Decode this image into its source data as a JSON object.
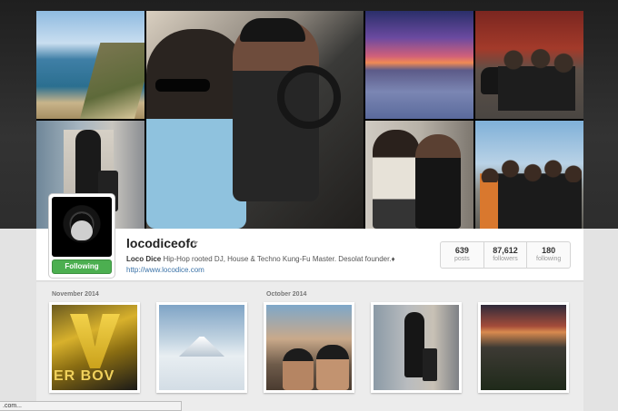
{
  "profile": {
    "username": "locodiceofc",
    "follow_label": "Following",
    "display_name": "Loco Dice",
    "bio": " Hip-Hop rooted DJ, House & Techno Kung-Fu Master. Desolat founder.♦",
    "website": "http://www.locodice.com"
  },
  "stats": [
    {
      "value": "639",
      "label": "posts"
    },
    {
      "value": "87,612",
      "label": "followers"
    },
    {
      "value": "180",
      "label": "following"
    }
  ],
  "feed": {
    "months": [
      "November 2014",
      "October 2014"
    ],
    "thumb1_text": "ER BOV"
  },
  "status_bar": {
    "url": ".com..."
  }
}
